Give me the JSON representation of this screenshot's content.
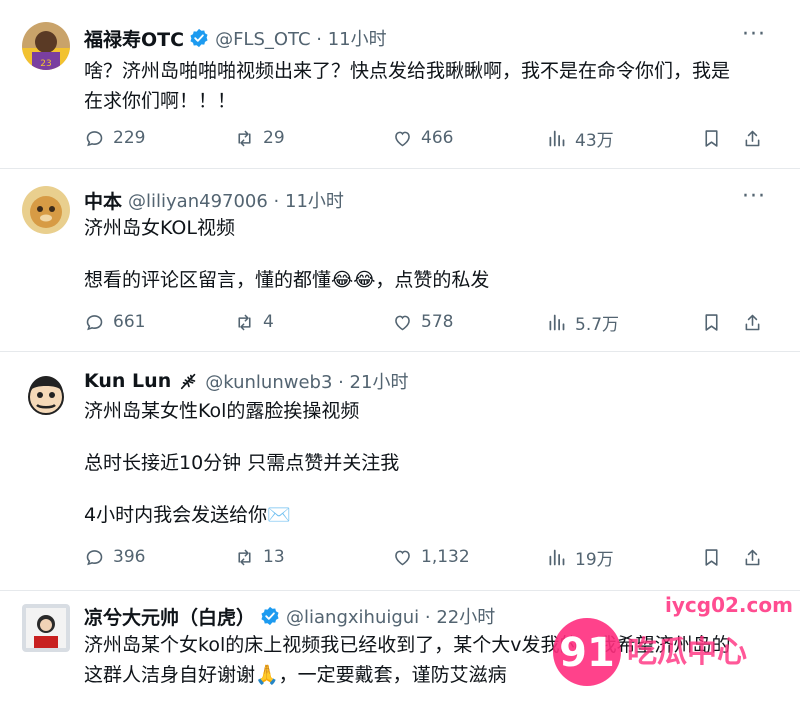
{
  "tweets": [
    {
      "name": "福禄寿OTC",
      "verified": true,
      "handle": "@FLS_OTC · 11小时",
      "lines": [
        "啥？济州岛啪啪啪视频出来了？快点发给我瞅瞅啊，我不是在命令你们，我是",
        "在求你们啊！！！"
      ],
      "stats": {
        "replies": "229",
        "reposts": "29",
        "likes": "466",
        "views": "43万"
      }
    },
    {
      "name": "中本",
      "verified": false,
      "handle": "@liliyan497006 · 11小时",
      "lines": [
        "济州岛女KOL视频",
        "想看的评论区留言，懂的都懂😂😂，点赞的私发"
      ],
      "stats": {
        "replies": "661",
        "reposts": "4",
        "likes": "578",
        "views": "5.7万"
      }
    },
    {
      "name": "Kun Lun",
      "verified": false,
      "handle": "@kunlunweb3 · 21小时",
      "lines": [
        "济州岛某女性Kol的露脸挨操视频",
        "总时长接近10分钟 只需点赞并关注我",
        "4小时内我会发送给你✉️"
      ],
      "stats": {
        "replies": "396",
        "reposts": "13",
        "likes": "1,132",
        "views": "19万"
      }
    },
    {
      "name": "凉兮大元帅（白虎）",
      "verified": true,
      "handle": "@liangxihuigui · 22小时",
      "lines": [
        "济州岛某个女kol的床上视频我已经收到了，某个大v发我的，我希望济州岛的",
        "这群人洁身自好谢谢🙏，一定要戴套，谨防艾滋病"
      ]
    }
  ],
  "watermark": {
    "site": "iycg02.com",
    "number": "91",
    "text": "吃瓜中心"
  },
  "colors": {
    "verified": "#1d9bf0",
    "muted": "#536471",
    "watermark_pink": "#ff2e7e"
  }
}
